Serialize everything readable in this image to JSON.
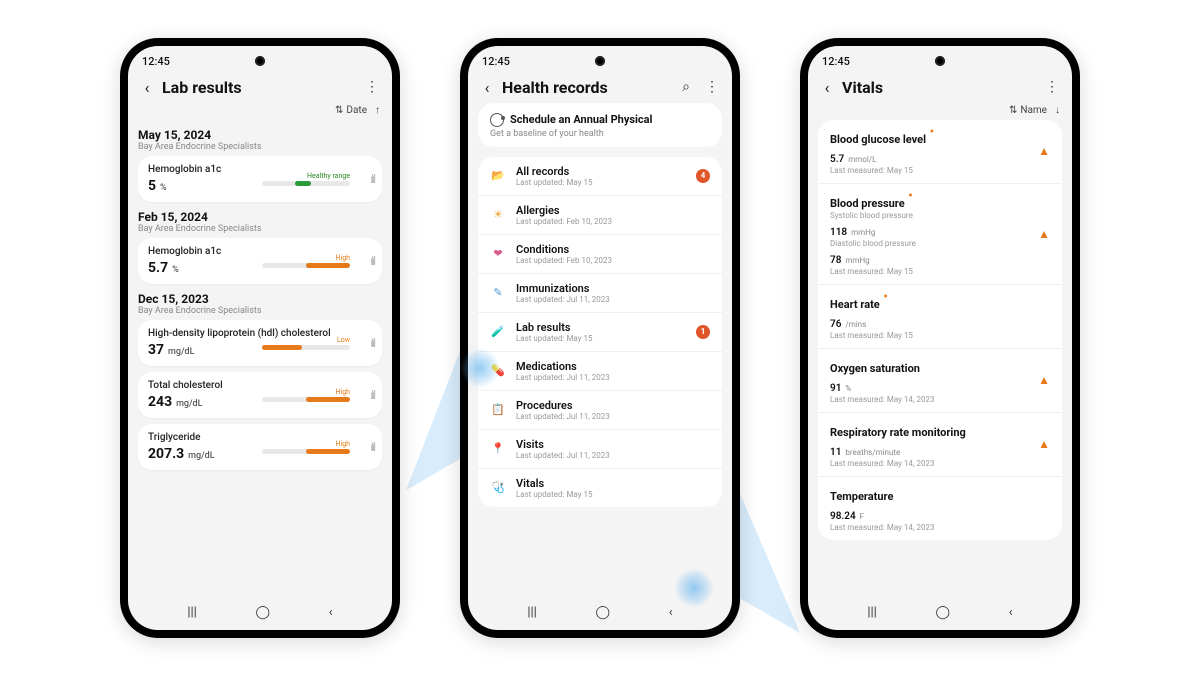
{
  "statusbar_time": "12:45",
  "screens": {
    "lab": {
      "title": "Lab results",
      "sort_label": "Date",
      "groups": [
        {
          "date": "May 15, 2024",
          "provider": "Bay Area Endocrine Specialists",
          "items": [
            {
              "name": "Hemoglobin a1c",
              "value": "5",
              "unit": "%",
              "range_label": "Healthy range",
              "range_style": "green",
              "fill_left": "38%",
              "fill_width": "18%"
            }
          ]
        },
        {
          "date": "Feb 15, 2024",
          "provider": "Bay Area Endocrine Specialists",
          "items": [
            {
              "name": "Hemoglobin a1c",
              "value": "5.7",
              "unit": "%",
              "range_label": "High",
              "range_style": "orange",
              "fill_left": "50%",
              "fill_width": "50%"
            }
          ]
        },
        {
          "date": "Dec 15, 2023",
          "provider": "Bay Area Endocrine Specialists",
          "items": [
            {
              "name": "High-density lipoprotein (hdl) cholesterol",
              "value": "37",
              "unit": "mg/dL",
              "range_label": "Low",
              "range_style": "orange",
              "fill_left": "0%",
              "fill_width": "45%"
            },
            {
              "name": "Total cholesterol",
              "value": "243",
              "unit": "mg/dL",
              "range_label": "High",
              "range_style": "orange",
              "fill_left": "50%",
              "fill_width": "50%"
            },
            {
              "name": "Triglyceride",
              "value": "207.3",
              "unit": "mg/dL",
              "range_label": "High",
              "range_style": "orange",
              "fill_left": "50%",
              "fill_width": "50%"
            }
          ]
        }
      ]
    },
    "records": {
      "title": "Health records",
      "promo_title": "Schedule an Annual Physical",
      "promo_sub": "Get a baseline of your health",
      "items": [
        {
          "icon": "📂",
          "icon_color": "#2a9a7a",
          "label": "All records",
          "sub": "Last updated: May 15",
          "badge": "4"
        },
        {
          "icon": "☀",
          "icon_color": "#e8a530",
          "label": "Allergies",
          "sub": "Last updated: Feb 10, 2023",
          "badge": ""
        },
        {
          "icon": "❤",
          "icon_color": "#d85a8a",
          "label": "Conditions",
          "sub": "Last updated: Feb 10, 2023",
          "badge": ""
        },
        {
          "icon": "✎",
          "icon_color": "#4a9ad8",
          "label": "Immunizations",
          "sub": "Last updated: Jul 11, 2023",
          "badge": ""
        },
        {
          "icon": "🧪",
          "icon_color": "#4a7ad8",
          "label": "Lab results",
          "sub": "Last updated: May 15",
          "badge": "1"
        },
        {
          "icon": "💊",
          "icon_color": "#9a7a5a",
          "label": "Medications",
          "sub": "Last updated: Jul 11, 2023",
          "badge": ""
        },
        {
          "icon": "📋",
          "icon_color": "#3aa88a",
          "label": "Procedures",
          "sub": "Last updated: Jul 11, 2023",
          "badge": ""
        },
        {
          "icon": "📍",
          "icon_color": "#3a6ad8",
          "label": "Visits",
          "sub": "Last updated: Jul 11, 2023",
          "badge": ""
        },
        {
          "icon": "🩺",
          "icon_color": "#d84a3a",
          "label": "Vitals",
          "sub": "Last updated: May 15",
          "badge": ""
        }
      ]
    },
    "vitals": {
      "title": "Vitals",
      "sort_label": "Name",
      "items": [
        {
          "name": "Blood glucose level",
          "dot": true,
          "lines": [
            {
              "v": "5.7",
              "u": "mmol/L"
            }
          ],
          "last": "Last measured: May 15",
          "warn": true
        },
        {
          "name": "Blood pressure",
          "dot": true,
          "bp": true,
          "sysLabel": "Systolic blood pressure",
          "sysV": "118",
          "sysU": "mmHg",
          "diaLabel": "Diastolic blood pressure",
          "diaV": "78",
          "diaU": "mmHg",
          "last": "Last measured: May 15",
          "warn": true
        },
        {
          "name": "Heart rate",
          "dot": true,
          "lines": [
            {
              "v": "76",
              "u": "/mins"
            }
          ],
          "last": "Last measured: May 15",
          "warn": false
        },
        {
          "name": "Oxygen saturation",
          "dot": false,
          "lines": [
            {
              "v": "91",
              "u": "%"
            }
          ],
          "last": "Last measured: May 14, 2023",
          "warn": true
        },
        {
          "name": "Respiratory rate monitoring",
          "dot": false,
          "lines": [
            {
              "v": "11",
              "u": "breaths/minute"
            }
          ],
          "last": "Last measured: May 14, 2023",
          "warn": true
        },
        {
          "name": "Temperature",
          "dot": false,
          "lines": [
            {
              "v": "98.24",
              "u": "F"
            }
          ],
          "last": "Last measured: May 14, 2023",
          "warn": false
        }
      ]
    }
  }
}
